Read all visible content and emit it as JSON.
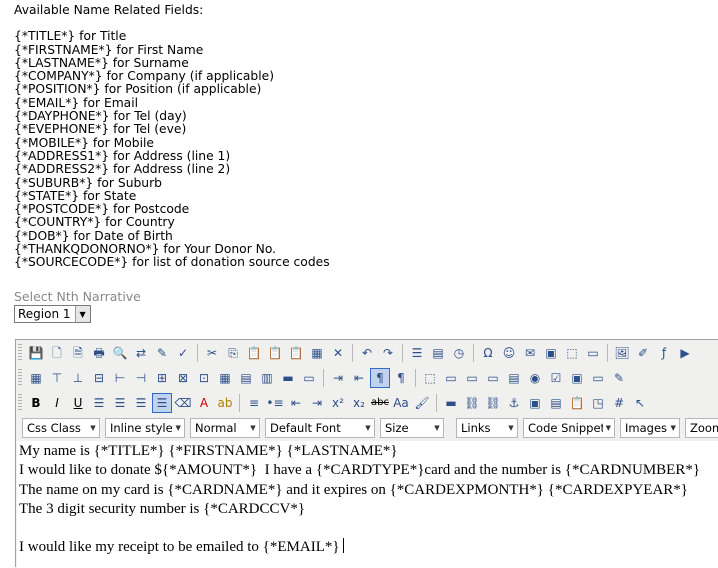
{
  "fields": {
    "heading": "Available Name Related Fields:",
    "items": [
      "{*TITLE*} for Title",
      "{*FIRSTNAME*} for First Name",
      "{*LASTNAME*} for Surname",
      "{*COMPANY*} for Company (if applicable)",
      "{*POSITION*} for Position (if applicable)",
      "{*EMAIL*} for Email",
      "{*DAYPHONE*} for Tel (day)",
      "{*EVEPHONE*} for Tel (eve)",
      "{*MOBILE*} for Mobile",
      "{*ADDRESS1*} for Address (line 1)",
      "{*ADDRESS2*} for Address (line 2)",
      "{*SUBURB*} for Suburb",
      "{*STATE*} for State",
      "{*POSTCODE*} for Postcode",
      "{*COUNTRY*} for Country",
      "{*DOB*} for Date of Birth",
      "{*THANKQDONORNO*} for Your Donor No.",
      "{*SOURCECODE*} for list of donation source codes"
    ]
  },
  "narrative": {
    "label": "Select Nth Narrative",
    "selected": "Region 1"
  },
  "toolbar": {
    "row1": [
      "save-icon",
      "new-document-icon",
      "templates-icon",
      "print-icon",
      "find-icon",
      "find-replace-icon",
      "cleanup-icon",
      "spellcheck-icon",
      "cut-icon",
      "copy-icon",
      "paste-icon",
      "paste-text-icon",
      "paste-word-icon",
      "select-all-icon",
      "delete-icon",
      "undo-icon",
      "redo-icon",
      "page-break-icon",
      "insert-date-icon",
      "insert-time-icon",
      "special-char-icon",
      "emoticon-icon",
      "media-icon",
      "anchor-box-icon",
      "layer-icon",
      "style-icon",
      "image-manager-icon",
      "edit-image-icon",
      "flash-icon",
      "play-icon"
    ],
    "row2": [
      "table-icon",
      "insert-row-before-icon",
      "insert-row-after-icon",
      "delete-row-icon",
      "insert-col-before-icon",
      "insert-col-after-icon",
      "delete-col-icon",
      "split-cells-icon",
      "merge-cells-icon",
      "table-props-icon",
      "row-props-icon",
      "cell-props-icon",
      "hr-table-icon",
      "td-icon",
      "ltr-icon",
      "rtl-icon",
      "show-blocks-icon",
      "visual-aid-icon",
      "form-icon",
      "textfield-icon",
      "textarea-icon",
      "password-icon",
      "list-box-icon",
      "radio-icon",
      "checkbox-icon",
      "image-button-icon",
      "button-icon",
      "pen-icon"
    ],
    "row3": {
      "bold": "B",
      "italic": "I",
      "underline": "U",
      "superscript": "x²",
      "subscript": "x₂",
      "strike": "abc",
      "icons": [
        "align-left-icon",
        "align-center-icon",
        "align-right-icon",
        "justify-icon",
        "eraser-icon",
        "font-color-icon",
        "highlight-icon",
        "ordered-list-icon",
        "unordered-list-icon",
        "outdent-icon",
        "indent-icon",
        "strikethrough-icon",
        "case-icon",
        "format-painter-icon",
        "horizontal-rule-icon",
        "link-icon",
        "unlink-icon",
        "anchor-icon",
        "insert-image-icon",
        "template-icon",
        "clipboard-icon",
        "image-map-icon",
        "grid-icon",
        "select-pointer-icon"
      ]
    },
    "dropdowns": [
      {
        "name": "css-class-dropdown",
        "label": "Css Class"
      },
      {
        "name": "inline-style-dropdown",
        "label": "Inline style"
      },
      {
        "name": "paragraph-format-dropdown",
        "label": "Normal"
      },
      {
        "name": "font-family-dropdown",
        "label": "Default Font"
      },
      {
        "name": "font-size-dropdown",
        "label": "Size"
      },
      {
        "name": "links-dropdown",
        "label": "Links"
      },
      {
        "name": "code-snippet-dropdown",
        "label": "Code Snippet"
      },
      {
        "name": "images-dropdown",
        "label": "Images"
      },
      {
        "name": "zoom-dropdown",
        "label": "Zoom"
      }
    ]
  },
  "content": {
    "lines": [
      "My name is {*TITLE*} {*FIRSTNAME*} {*LASTNAME*}",
      "I would like to donate ${*AMOUNT*}  I have a {*CARDTYPE*}card and the number is {*CARDNUMBER*}",
      "The name on my card is {*CARDNAME*} and it expires on {*CARDEXPMONTH*} {*CARDEXPYEAR*}",
      "The 3 digit security number is {*CARDCCV*}"
    ],
    "last_line": "I would like my receipt to be emailed to {*EMAIL*}"
  }
}
